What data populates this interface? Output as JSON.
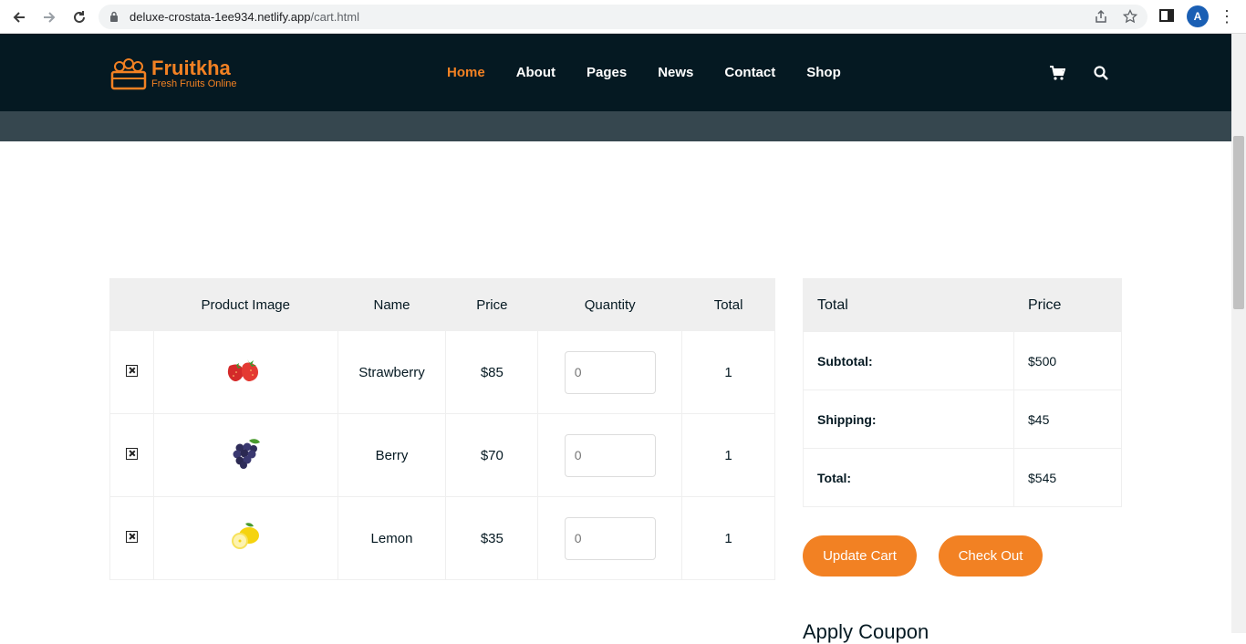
{
  "browser": {
    "url_host": "deluxe-crostata-1ee934.netlify.app",
    "url_path": "/cart.html",
    "avatar_letter": "A"
  },
  "header": {
    "logo_title": "Fruitkha",
    "logo_subtitle": "Fresh Fruits Online",
    "menu": [
      {
        "label": "Home",
        "active": true
      },
      {
        "label": "About"
      },
      {
        "label": "Pages"
      },
      {
        "label": "News"
      },
      {
        "label": "Contact"
      },
      {
        "label": "Shop"
      }
    ],
    "accent_color": "#F28123",
    "bg_color": "#051922"
  },
  "cart": {
    "headers": [
      "",
      "Product Image",
      "Name",
      "Price",
      "Quantity",
      "Total"
    ],
    "rows": [
      {
        "name": "Strawberry",
        "price": "$85",
        "quantity": "0",
        "total": "1",
        "image_icon": "strawberry-image"
      },
      {
        "name": "Berry",
        "price": "$70",
        "quantity": "0",
        "total": "1",
        "image_icon": "grapes-image"
      },
      {
        "name": "Lemon",
        "price": "$35",
        "quantity": "0",
        "total": "1",
        "image_icon": "lemon-image"
      }
    ]
  },
  "totals": {
    "headers": [
      "Total",
      "Price"
    ],
    "rows": [
      {
        "label": "Subtotal:",
        "value": "$500"
      },
      {
        "label": "Shipping:",
        "value": "$45"
      },
      {
        "label": "Total:",
        "value": "$545"
      }
    ]
  },
  "buttons": {
    "update_cart": "Update Cart",
    "check_out": "Check Out"
  },
  "coupon": {
    "title": "Apply Coupon"
  }
}
